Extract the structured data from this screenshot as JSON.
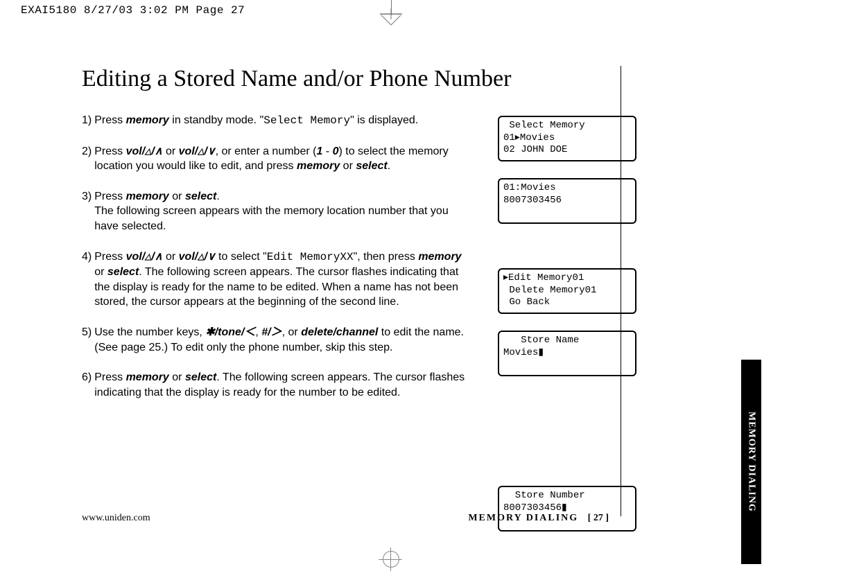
{
  "print_header": "EXAI5180  8/27/03 3:02 PM  Page 27",
  "title": "Editing a Stored Name and/or Phone Number",
  "steps": {
    "s1": {
      "num": "1)",
      "pre": "Press ",
      "k1": "memory",
      "mid1": " in standby mode. \"",
      "lcd": "Select Memory",
      "post": "\" is displayed."
    },
    "s2": {
      "num": "2)",
      "pre": "Press ",
      "k1": "vol/",
      "sym1": "△/∧",
      "or": " or ",
      "k2": "vol/",
      "sym2": "△/∨",
      "mid": ", or enter a number (",
      "r1": "1",
      "dash": " - ",
      "r0": "0",
      "mid2": ") to select the memory location you would like to edit, and press ",
      "k3": "memory",
      "or2": " or ",
      "k4": "select",
      "end": "."
    },
    "s3": {
      "num": "3)",
      "pre": "Press ",
      "k1": "memory",
      "or": " or ",
      "k2": "select",
      "end": ".",
      "line2": "The following screen appears with the memory location number that you have selected."
    },
    "s4": {
      "num": "4)",
      "pre": "Press ",
      "k1": "vol/",
      "sym1": "△/∧",
      "or": " or ",
      "k2": "vol/",
      "sym2": "△/∨",
      "mid": " to select \"",
      "lcd": "Edit MemoryXX",
      "mid2": "\", then press ",
      "k3": "memory",
      "or2": " or ",
      "k4": "select",
      "rest": ". The following screen appears. The cursor flashes indicating that the display is ready for the name to be edited. When a name has not been stored, the cursor appears at the beginning of the second line."
    },
    "s5": {
      "num": "5)",
      "pre": "Use the number keys, ",
      "k1": "✱/tone/＜",
      "c1": ", ",
      "k2": "#/＞",
      "c2": ", or ",
      "k3": "delete/channel",
      "rest": " to edit the name. (See page 25.) To edit only the phone number, skip this step."
    },
    "s6": {
      "num": "6)",
      "pre": "Press ",
      "k1": "memory",
      "or": " or ",
      "k2": "select",
      "rest": ". The following screen appears. The cursor flashes indicating that the display is ready for the number to be edited."
    }
  },
  "screens": {
    "sc1": " Select Memory\n01▸Movies\n02 JOHN DOE",
    "sc2": "01:Movies\n8007303456\n ",
    "sc3": "▸Edit Memory01\n Delete Memory01\n Go Back",
    "sc4": "   Store Name\nMovies▮\n ",
    "sc5": "  Store Number\n8007303456▮\n "
  },
  "footer": {
    "url": "www.uniden.com",
    "section": "MEMORY DIALING",
    "page": "[ 27 ]"
  },
  "side_tab": "MEMORY DIALING"
}
